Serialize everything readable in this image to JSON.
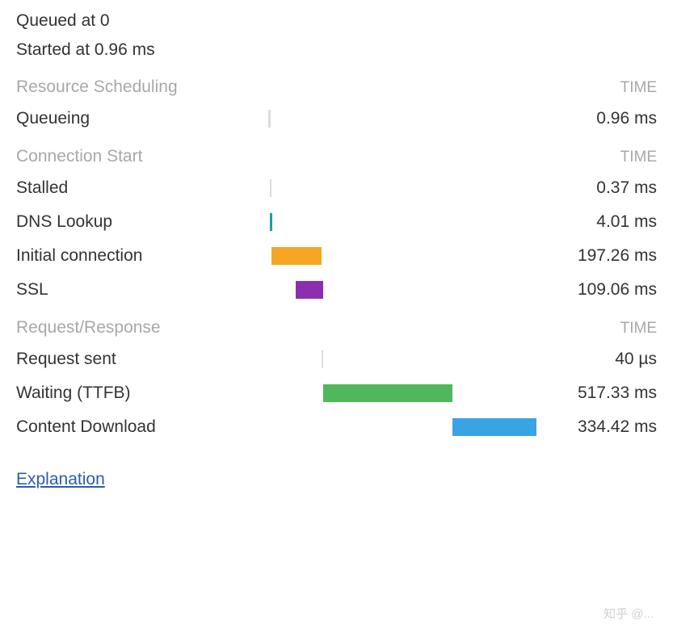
{
  "header": {
    "queued": "Queued at 0",
    "started": "Started at 0.96 ms"
  },
  "sections": {
    "resource_scheduling": {
      "title": "Resource Scheduling",
      "time_header": "TIME"
    },
    "connection_start": {
      "title": "Connection Start",
      "time_header": "TIME"
    },
    "request_response": {
      "title": "Request/Response",
      "time_header": "TIME"
    }
  },
  "rows": {
    "queueing": {
      "label": "Queueing",
      "value": "0.96 ms"
    },
    "stalled": {
      "label": "Stalled",
      "value": "0.37 ms"
    },
    "dns_lookup": {
      "label": "DNS Lookup",
      "value": "4.01 ms"
    },
    "initial_connection": {
      "label": "Initial connection",
      "value": "197.26 ms"
    },
    "ssl": {
      "label": "SSL",
      "value": "109.06 ms"
    },
    "request_sent": {
      "label": "Request sent",
      "value": "40 µs"
    },
    "waiting_ttfb": {
      "label": "Waiting (TTFB)",
      "value": "517.33 ms"
    },
    "content_download": {
      "label": "Content Download",
      "value": "334.42 ms"
    }
  },
  "colors": {
    "queueing": "#dcdcdc",
    "stalled": "#dcdcdc",
    "dns": "#1aa0a0",
    "initial_connection": "#f5a623",
    "ssl": "#8b2fb0",
    "request_sent": "#dcdcdc",
    "waiting": "#4fb85a",
    "content_download": "#3aa3e3"
  },
  "explanation": "Explanation",
  "watermark": "知乎 @..."
}
